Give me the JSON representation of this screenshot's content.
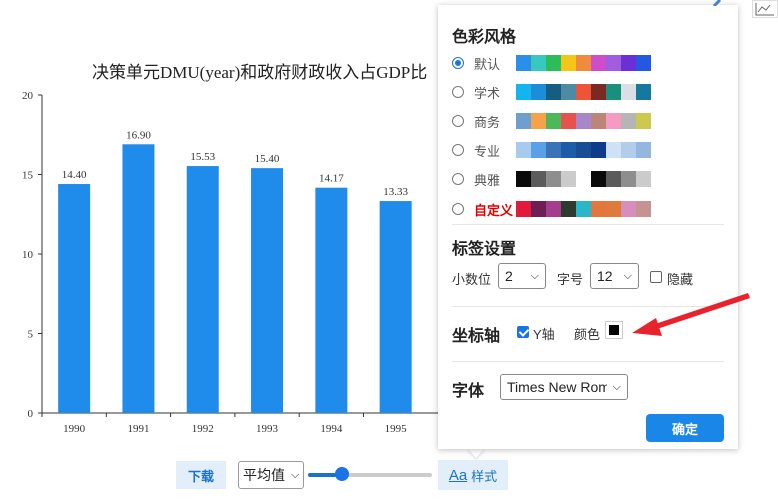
{
  "chart_data": {
    "type": "bar",
    "title": "决策单元DMU(year)和政府财政收入占GDP比",
    "categories": [
      "1990",
      "1991",
      "1992",
      "1993",
      "1994",
      "1995"
    ],
    "values": [
      14.4,
      16.9,
      15.53,
      15.4,
      14.17,
      13.33
    ],
    "value_labels": [
      "14.40",
      "16.90",
      "15.53",
      "15.40",
      "14.17",
      "13.33"
    ],
    "yticks": [
      "0",
      "5",
      "10",
      "15",
      "20"
    ],
    "ylim": [
      0,
      20
    ],
    "bar_color": "#1f8bea",
    "grid": false
  },
  "bottom": {
    "download_label": "下载",
    "stat_select_value": "平均值",
    "slider_value": 0.27,
    "style_aa": "Aa",
    "style_label": "样式"
  },
  "panel": {
    "color_title": "色彩风格",
    "schemes": [
      {
        "name": "默认",
        "checked": true,
        "colors": [
          "#2b8ee8",
          "#37c9c0",
          "#2ebc5a",
          "#f5c518",
          "#f08a3c",
          "#ce4dc9",
          "#a05ddf",
          "#6b2fd8",
          "#2458e0"
        ]
      },
      {
        "name": "学术",
        "checked": false,
        "colors": [
          "#13b4ef",
          "#1a8fd8",
          "#155e82",
          "#4f8aa3",
          "#ee5437",
          "#7a2a23",
          "#19907b",
          "#d9dfe4",
          "#17789f"
        ]
      },
      {
        "name": "商务",
        "checked": false,
        "colors": [
          "#6f9fcf",
          "#f6a24a",
          "#4eb75c",
          "#e6534c",
          "#a887c9",
          "#bb8578",
          "#f49ac3",
          "#b5b5b5",
          "#ccc94e"
        ]
      },
      {
        "name": "专业",
        "checked": false,
        "colors": [
          "#a6cbef",
          "#5aa0e6",
          "#3b73b7",
          "#1e5ca8",
          "#1a4c95",
          "#0f3c8a",
          "#cfe1f4",
          "#b2cdea",
          "#94b8dd"
        ]
      },
      {
        "name": "典雅",
        "checked": false,
        "colors": [
          "#0a0a0a",
          "#5b5b5b",
          "#8e8e8e",
          "#cbcbcb",
          "#ffffff",
          "#0a0a0a",
          "#5b5b5b",
          "#8e8e8e",
          "#cbcbcb"
        ]
      },
      {
        "name": "自定义",
        "checked": false,
        "custom": true,
        "colors": [
          "#e11a3c",
          "#6d1f55",
          "#a43d8e",
          "#2c3b2e",
          "#28b6c8",
          "#e3763d",
          "#e07a3a",
          "#d68fbd",
          "#c79392"
        ]
      }
    ],
    "label_title": "标签设置",
    "decimal_label": "小数位",
    "decimal_value": "2",
    "fontsize_label": "字号",
    "fontsize_value": "12",
    "hide_label": "隐藏",
    "axis_title": "坐标轴",
    "yaxis_label": "Y轴",
    "color_label": "颜色",
    "axis_color": "#000000",
    "font_title": "字体",
    "font_value": "Times New Roman",
    "ok_label": "确定"
  },
  "colors": {
    "accent": "#1a73e8",
    "arrow": "#e8232e"
  }
}
